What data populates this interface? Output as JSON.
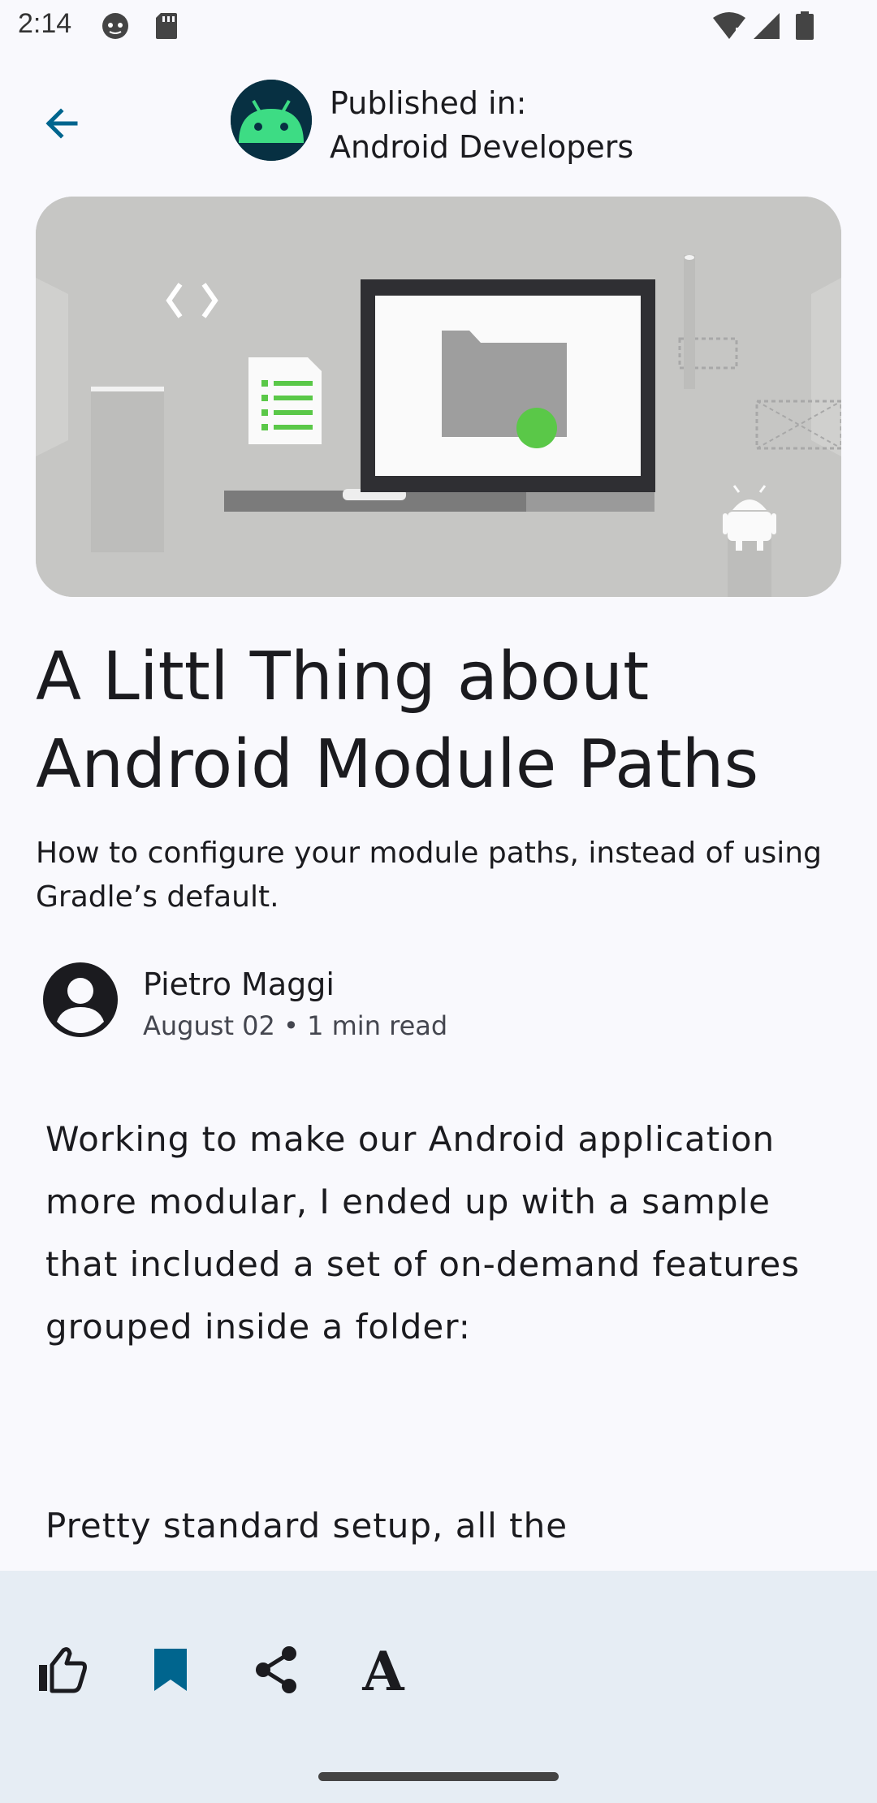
{
  "status_bar": {
    "time": "2:14",
    "icons": [
      "cat-icon",
      "sd-card-icon",
      "wifi-icon",
      "signal-icon",
      "battery-icon"
    ]
  },
  "top_bar": {
    "back_icon": "arrow-back-icon",
    "publisher_label": "Published in:",
    "publisher_name": "Android Developers"
  },
  "article": {
    "title": "A Littl Thing about Android Module Paths",
    "subtitle": "How to configure your module paths, instead of using Gradle’s default.",
    "author": "Pietro Maggi",
    "meta": "August 02 • 1 min read",
    "paragraph_1": "Working to make our Android application more modular, I ended up with a sample that included a set of on-demand features grouped inside a folder:",
    "paragraph_2": "Pretty standard setup, all the"
  },
  "bottom_bar": {
    "actions": [
      "thumb-up-icon",
      "bookmark-icon",
      "share-icon",
      "text-size-icon"
    ],
    "font_label": "A"
  },
  "colors": {
    "accent": "#00658e",
    "bookmark": "#00658e",
    "bottom_bar_bg": "#e6edf4",
    "android_green": "#3ddc84",
    "dark_navy": "#073042"
  }
}
